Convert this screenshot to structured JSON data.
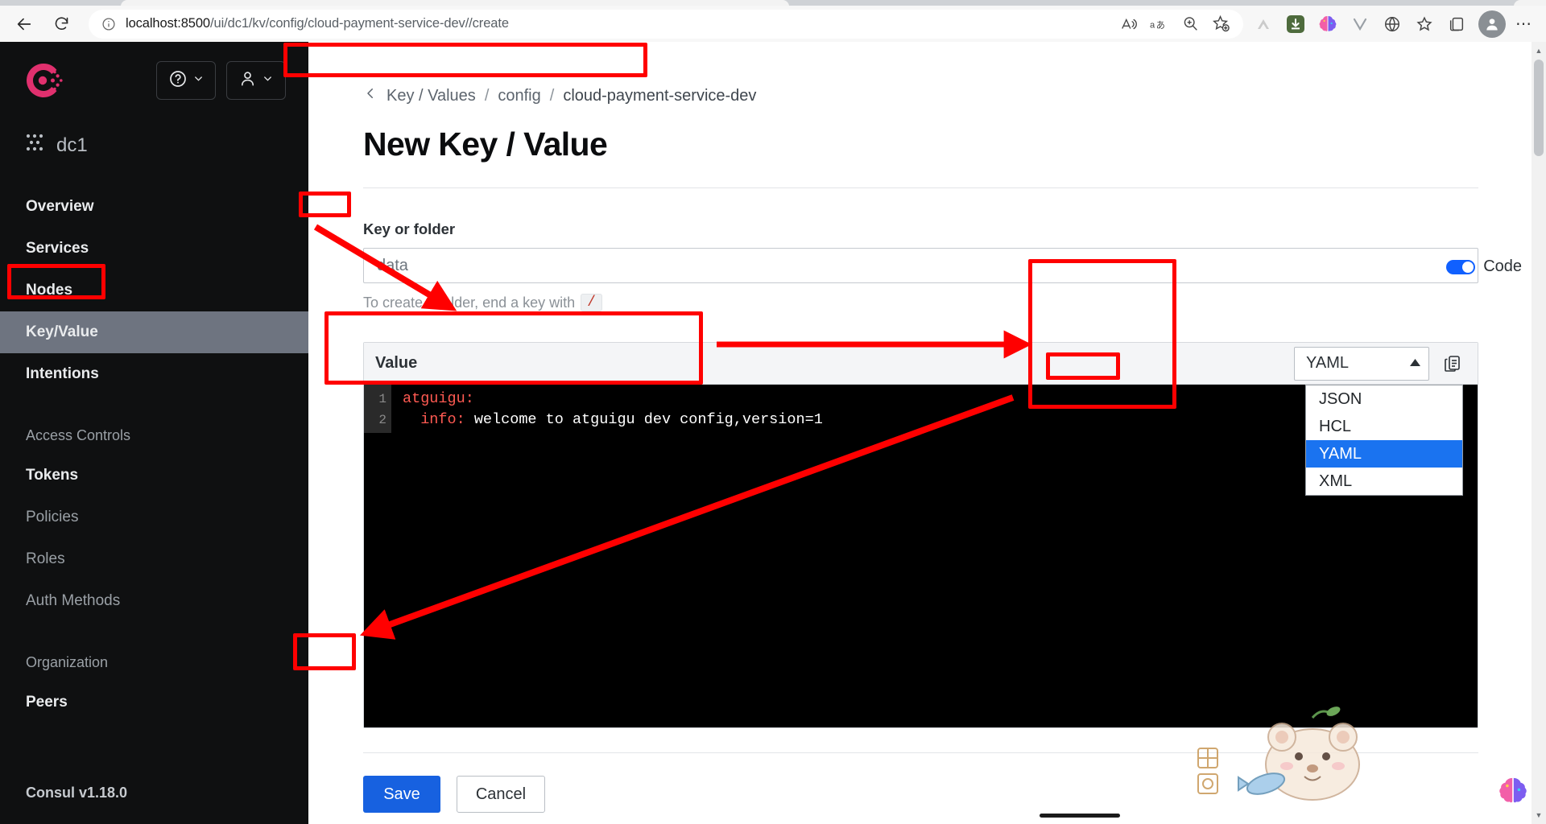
{
  "browser": {
    "url_host": "localhost:8500",
    "url_path": "/ui/dc1/kv/config/cloud-payment-service-dev//create",
    "back_icon": "back-arrow-icon",
    "reload_icon": "reload-icon",
    "site_info_icon": "info-circle-icon",
    "toolbar_icons": [
      "read-aloud-icon",
      "translate-icon",
      "zoom-icon",
      "add-favorite-icon"
    ],
    "extension_icons": [
      "arc-extension-icon",
      "download-manager-icon",
      "ai-brain-extension-icon",
      "v-extension-icon",
      "browser-essentials-icon",
      "collections-favorites-icon",
      "collections-icon"
    ],
    "profile_icon": "profile-avatar-icon",
    "more_icon": "more-settings-icon"
  },
  "sidebar": {
    "logo": "consul-logo-icon",
    "help_button": {
      "icon": "help-question-icon",
      "caret": "chevron-down-icon"
    },
    "user_button": {
      "icon": "user-person-icon",
      "caret": "chevron-down-icon"
    },
    "datacenter": {
      "icon": "datacenter-nodes-icon",
      "label": "dc1"
    },
    "items": [
      {
        "label": "Overview",
        "active": false,
        "style": "bold"
      },
      {
        "label": "Services",
        "active": false,
        "style": "bold"
      },
      {
        "label": "Nodes",
        "active": false,
        "style": "bold"
      },
      {
        "label": "Key/Value",
        "active": true,
        "style": "bold"
      },
      {
        "label": "Intentions",
        "active": false,
        "style": "bold"
      }
    ],
    "section_label": "Access Controls",
    "acl_items": [
      {
        "label": "Tokens",
        "style": "bold"
      },
      {
        "label": "Policies",
        "style": "dim"
      },
      {
        "label": "Roles",
        "style": "dim"
      },
      {
        "label": "Auth Methods",
        "style": "dim"
      }
    ],
    "org_section_label": "Organization",
    "org_items": [
      {
        "label": "Peers",
        "style": "bold"
      }
    ],
    "version": "Consul v1.18.0"
  },
  "main": {
    "breadcrumb": {
      "back_icon": "chevron-left-icon",
      "crumbs": [
        "Key / Values",
        "config",
        "cloud-payment-service-dev"
      ],
      "separator": "/"
    },
    "title": "New Key / Value",
    "key_field": {
      "label": "Key or folder",
      "value": "data",
      "placeholder": "data",
      "hint_prefix": "To create a folder, end a key with",
      "hint_token": "/"
    },
    "code_toggle": {
      "label": "Code",
      "enabled": true
    },
    "editor": {
      "title": "Value",
      "language_selected": "YAML",
      "caret_icon": "chevron-up-icon",
      "copy_icon": "copy-to-clipboard-icon",
      "language_options": [
        "JSON",
        "HCL",
        "YAML",
        "XML"
      ],
      "lines": [
        {
          "number": "1",
          "key": "atguigu:",
          "rest": ""
        },
        {
          "number": "2",
          "key": "  info:",
          "rest": " welcome to atguigu dev config,version=1"
        }
      ]
    },
    "buttons": {
      "save": "Save",
      "cancel": "Cancel"
    }
  },
  "colors": {
    "accent_blue": "#1761e0",
    "annotation_red": "#ff0000",
    "consul_pink": "#e0306e",
    "sidebar_bg": "#0f1011",
    "editor_bg": "#000000",
    "code_key": "#ff5a52"
  }
}
